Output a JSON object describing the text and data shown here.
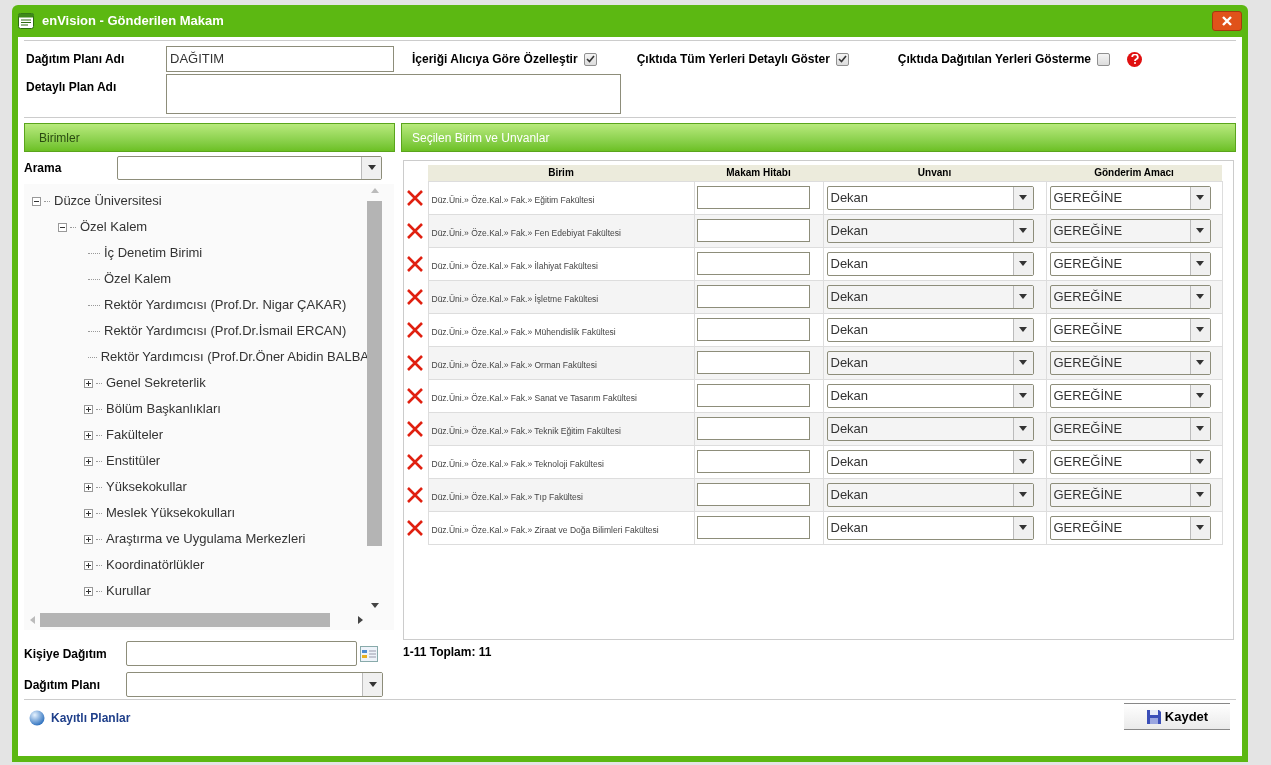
{
  "window": {
    "title": "enVision - Gönderilen Makam"
  },
  "form": {
    "plan_name": {
      "label": "Dağıtım Planı Adı",
      "value": "DAĞITIM"
    },
    "detailed_plan_name": {
      "label": "Detaylı Plan Adı"
    },
    "options": [
      {
        "label": "İçeriği Alıcıya Göre Özelleştir",
        "checked": true
      },
      {
        "label": "Çıktıda Tüm Yerleri Detaylı Göster",
        "checked": true
      },
      {
        "label": "Çıktıda Dağıtılan Yerleri Gösterme",
        "checked": false
      }
    ]
  },
  "units_panel": {
    "title": "Birimler",
    "search_label": "Arama",
    "tree": [
      {
        "label": "Düzce Üniversitesi",
        "expanded": true,
        "children": [
          {
            "label": "Özel Kalem",
            "expanded": true,
            "children": [
              {
                "label": "İç Denetim Birimi"
              },
              {
                "label": "Özel Kalem"
              },
              {
                "label": "Rektör Yardımcısı (Prof.Dr. Nigar ÇAKAR)"
              },
              {
                "label": "Rektör Yardımcısı (Prof.Dr.İsmail ERCAN)"
              },
              {
                "label": "Rektör Yardımcısı (Prof.Dr.Öner Abidin BALBA"
              },
              {
                "label": "Genel Sekreterlik",
                "expanded": false
              },
              {
                "label": "Bölüm Başkanlıkları",
                "expanded": false
              },
              {
                "label": "Fakülteler",
                "expanded": false
              },
              {
                "label": "Enstitüler",
                "expanded": false
              },
              {
                "label": "Yüksekokullar",
                "expanded": false
              },
              {
                "label": "Meslek Yüksekokulları",
                "expanded": false
              },
              {
                "label": "Araştırma ve Uygulama Merkezleri",
                "expanded": false
              },
              {
                "label": "Koordinatörlükler",
                "expanded": false
              },
              {
                "label": "Kurullar",
                "expanded": false
              }
            ]
          }
        ]
      }
    ],
    "person_label": "Kişiye Dağıtım",
    "plan_label": "Dağıtım Planı"
  },
  "selected_panel": {
    "title": "Seçilen Birim ve Unvanlar",
    "table": {
      "columns": [
        "Birim",
        "Makam Hitabı",
        "Unvanı",
        "Gönderim Amacı"
      ],
      "rows": [
        {
          "birim": "Düz.Üni.» Öze.Kal.» Fak.» Eğitim Fakültesi",
          "unvan": "Dekan",
          "amac": "GEREĞİNE"
        },
        {
          "birim": "Düz.Üni.» Öze.Kal.» Fak.» Fen Edebiyat Fakültesi",
          "unvan": "Dekan",
          "amac": "GEREĞİNE"
        },
        {
          "birim": "Düz.Üni.» Öze.Kal.» Fak.» İlahiyat Fakültesi",
          "unvan": "Dekan",
          "amac": "GEREĞİNE"
        },
        {
          "birim": "Düz.Üni.» Öze.Kal.» Fak.» İşletme Fakültesi",
          "unvan": "Dekan",
          "amac": "GEREĞİNE"
        },
        {
          "birim": "Düz.Üni.» Öze.Kal.» Fak.» Mühendislik Fakültesi",
          "unvan": "Dekan",
          "amac": "GEREĞİNE"
        },
        {
          "birim": "Düz.Üni.» Öze.Kal.» Fak.» Orman Fakültesi",
          "unvan": "Dekan",
          "amac": "GEREĞİNE"
        },
        {
          "birim": "Düz.Üni.» Öze.Kal.» Fak.» Sanat ve Tasarım Fakültesi",
          "unvan": "Dekan",
          "amac": "GEREĞİNE"
        },
        {
          "birim": "Düz.Üni.» Öze.Kal.» Fak.» Teknik Eğitim Fakültesi",
          "unvan": "Dekan",
          "amac": "GEREĞİNE"
        },
        {
          "birim": "Düz.Üni.» Öze.Kal.» Fak.» Teknoloji Fakültesi",
          "unvan": "Dekan",
          "amac": "GEREĞİNE"
        },
        {
          "birim": "Düz.Üni.» Öze.Kal.» Fak.» Tıp Fakültesi",
          "unvan": "Dekan",
          "amac": "GEREĞİNE"
        },
        {
          "birim": "Düz.Üni.» Öze.Kal.» Fak.» Ziraat ve Doğa Bilimleri Fakültesi",
          "unvan": "Dekan",
          "amac": "GEREĞİNE"
        }
      ]
    },
    "pager": "1-11 Toplam: 11"
  },
  "footer": {
    "saved_plans": "Kayıtlı Planlar",
    "save_button": "Kaydet"
  }
}
